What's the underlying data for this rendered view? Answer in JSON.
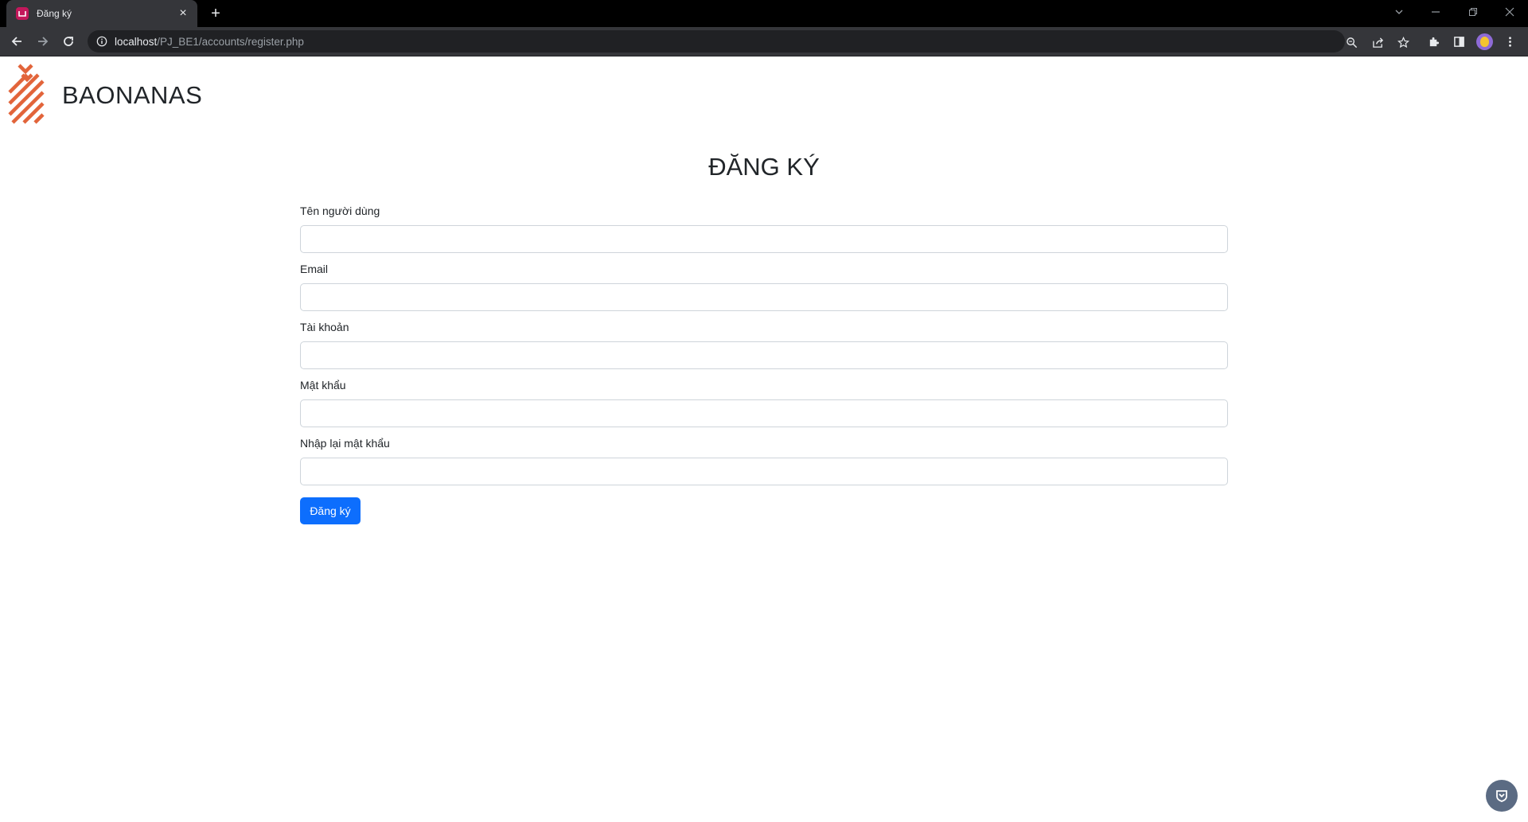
{
  "browser": {
    "tab_title": "Đăng ký",
    "new_tab_symbol": "+",
    "close_symbol": "×",
    "url_host": "localhost",
    "url_path": "/PJ_BE1/accounts/register.php",
    "icons": [
      "back-arrow-icon",
      "forward-arrow-icon",
      "reload-icon",
      "site-info-icon",
      "zoom-icon",
      "share-icon",
      "bookmark-star-icon",
      "extensions-puzzle-icon",
      "side-panel-icon",
      "profile-avatar",
      "more-menu-icon"
    ]
  },
  "brand": {
    "name": "BAONANAS",
    "logo_color": "#e2643a"
  },
  "form": {
    "title": "ĐĂNG KÝ",
    "fields": [
      {
        "label": "Tên người dùng",
        "value": ""
      },
      {
        "label": "Email",
        "value": ""
      },
      {
        "label": "Tài khoản",
        "value": ""
      },
      {
        "label": "Mật khẩu",
        "value": ""
      },
      {
        "label": "Nhập lại mật khẩu",
        "value": ""
      }
    ],
    "submit_label": "Đăng ký"
  },
  "colors": {
    "primary": "#0d6efd",
    "chrome_dark": "#35363a",
    "text": "#212529"
  }
}
